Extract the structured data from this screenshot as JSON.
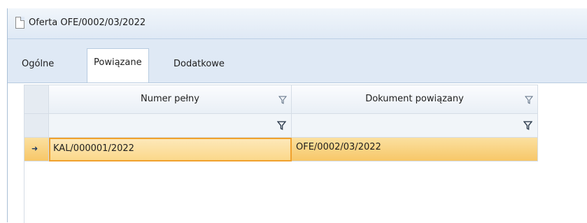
{
  "window": {
    "title": "Oferta OFE/0002/03/2022"
  },
  "tabs": [
    {
      "label": "Ogólne"
    },
    {
      "label": "Powiązane"
    },
    {
      "label": "Dodatkowe"
    }
  ],
  "grid": {
    "columns": [
      {
        "label": "Numer pełny"
      },
      {
        "label": "Dokument powiązany"
      }
    ],
    "rows": [
      {
        "numer": "KAL/000001/2022",
        "dokument": "OFE/0002/03/2022"
      }
    ]
  },
  "colors": {
    "selection": "#f7c768",
    "focus_border": "#f0a12d",
    "chrome": "#dfe9f5"
  }
}
